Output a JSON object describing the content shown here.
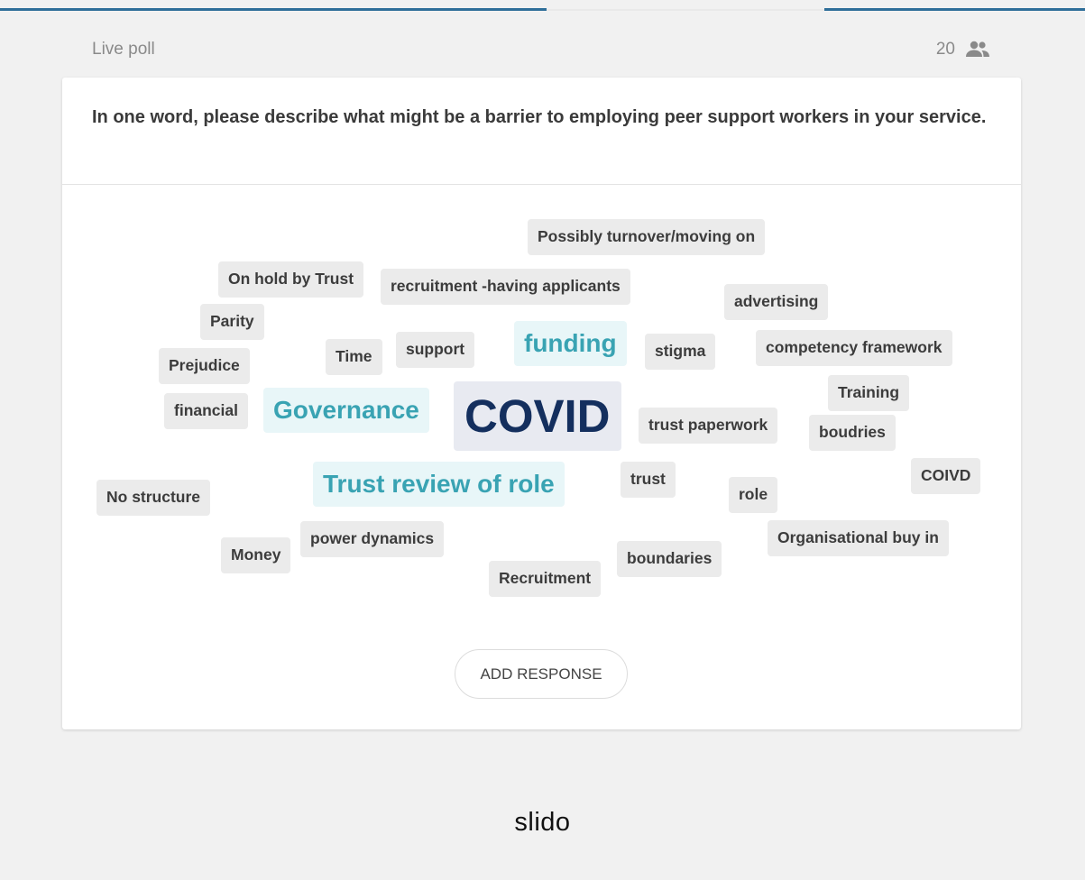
{
  "header": {
    "label": "Live poll",
    "participant_count": "20",
    "participant_icon": "people-icon"
  },
  "question": {
    "text": "In one word, please describe what might be a barrier to employing peer support workers in your service."
  },
  "word_cloud": {
    "words": [
      {
        "text": "Possibly turnover/moving on",
        "weight": "small"
      },
      {
        "text": "On hold by Trust",
        "weight": "small"
      },
      {
        "text": "recruitment -having applicants",
        "weight": "small"
      },
      {
        "text": "advertising",
        "weight": "small"
      },
      {
        "text": "Parity",
        "weight": "small"
      },
      {
        "text": "Time",
        "weight": "small"
      },
      {
        "text": "support",
        "weight": "small"
      },
      {
        "text": "funding",
        "weight": "medium"
      },
      {
        "text": "stigma",
        "weight": "small"
      },
      {
        "text": "competency framework",
        "weight": "small"
      },
      {
        "text": "Prejudice",
        "weight": "small"
      },
      {
        "text": "Training",
        "weight": "small"
      },
      {
        "text": "financial",
        "weight": "small"
      },
      {
        "text": "Governance",
        "weight": "medium"
      },
      {
        "text": "COVID",
        "weight": "large"
      },
      {
        "text": "trust paperwork",
        "weight": "small"
      },
      {
        "text": "boudries",
        "weight": "small"
      },
      {
        "text": "Trust review of role",
        "weight": "medium"
      },
      {
        "text": "trust",
        "weight": "small"
      },
      {
        "text": "COIVD",
        "weight": "small"
      },
      {
        "text": "No structure",
        "weight": "small"
      },
      {
        "text": "role",
        "weight": "small"
      },
      {
        "text": "power dynamics",
        "weight": "small"
      },
      {
        "text": "Organisational buy in",
        "weight": "small"
      },
      {
        "text": "Money",
        "weight": "small"
      },
      {
        "text": "boundaries",
        "weight": "small"
      },
      {
        "text": "Recruitment",
        "weight": "small"
      }
    ]
  },
  "actions": {
    "add_response_label": "ADD RESPONSE"
  },
  "footer": {
    "brand": "slido"
  },
  "colors": {
    "progress_accent": "#2e6e99",
    "word_large": "#142f5e",
    "word_medium": "#39a3b3",
    "chip_background": "#ebebeb"
  }
}
